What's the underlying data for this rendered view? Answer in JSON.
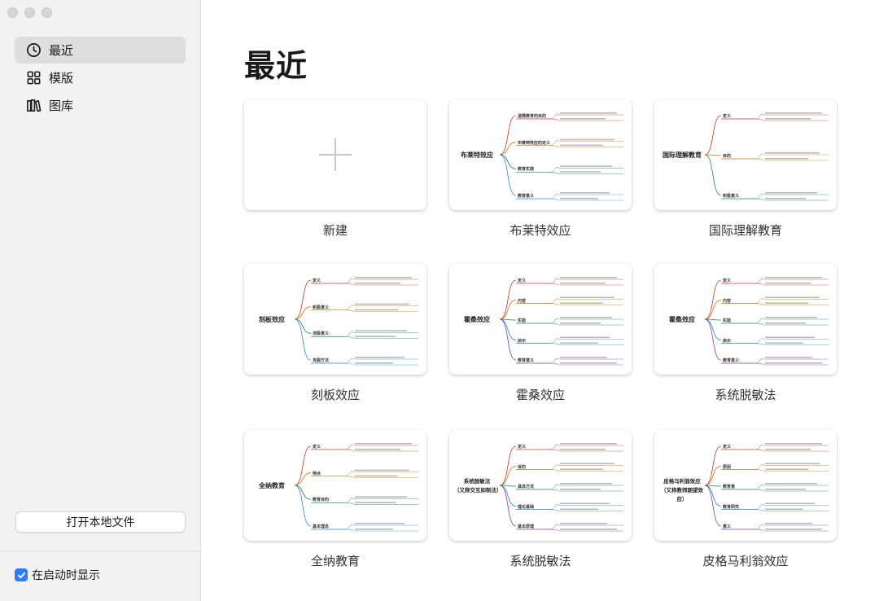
{
  "sidebar": {
    "nav": [
      {
        "label": "最近",
        "icon": "clock-icon",
        "active": true
      },
      {
        "label": "模版",
        "icon": "grid-icon",
        "active": false
      },
      {
        "label": "图库",
        "icon": "books-icon",
        "active": false
      }
    ],
    "open_local": "打开本地文件",
    "show_on_startup": {
      "label": "在启动时显示",
      "checked": true
    }
  },
  "main": {
    "title": "最近",
    "new_label": "新建",
    "files": [
      {
        "name": "布莱特效应",
        "root": "布莱特效应",
        "branches": [
          "温情教育的目的",
          "布莱特效应的定义",
          "教育实践",
          "教育意义"
        ]
      },
      {
        "name": "国际理解教育",
        "root": "国际理解教育",
        "branches": [
          "定义",
          "目的",
          "积极意义"
        ]
      },
      {
        "name": "刻板效应",
        "root": "刻板效应",
        "branches": [
          "定义",
          "积极意义",
          "消极意义",
          "克服方法"
        ]
      },
      {
        "name": "霍桑效应",
        "root": "霍桑效应",
        "branches": [
          "定义",
          "内容",
          "实验",
          "启示",
          "教育意义"
        ]
      },
      {
        "name": "系统脱敏法",
        "root": "霍桑效应",
        "branches": [
          "定义",
          "内容",
          "实验",
          "启示",
          "教育意义"
        ]
      },
      {
        "name": "全纳教育",
        "root": "全纳教育",
        "branches": [
          "定义",
          "特点",
          "教育目的",
          "基本理念"
        ]
      },
      {
        "name": "系统脱敏法",
        "root": "系统脱敏法\n（又称交互抑制法）",
        "branches": [
          "定义",
          "目的",
          "具体方法",
          "理论基础",
          "基本原理"
        ]
      },
      {
        "name": "皮格马利翁效应",
        "root": "皮格马利翁效应\n（又称教师期望效应）",
        "branches": [
          "定义",
          "原因",
          "教育意",
          "教育研究",
          "意义"
        ]
      }
    ]
  },
  "colors": {
    "accent": "#2f7cf6",
    "branch": [
      "#c0392b",
      "#b9770e",
      "#1e8449",
      "#2e86c1",
      "#7d3c98"
    ]
  }
}
